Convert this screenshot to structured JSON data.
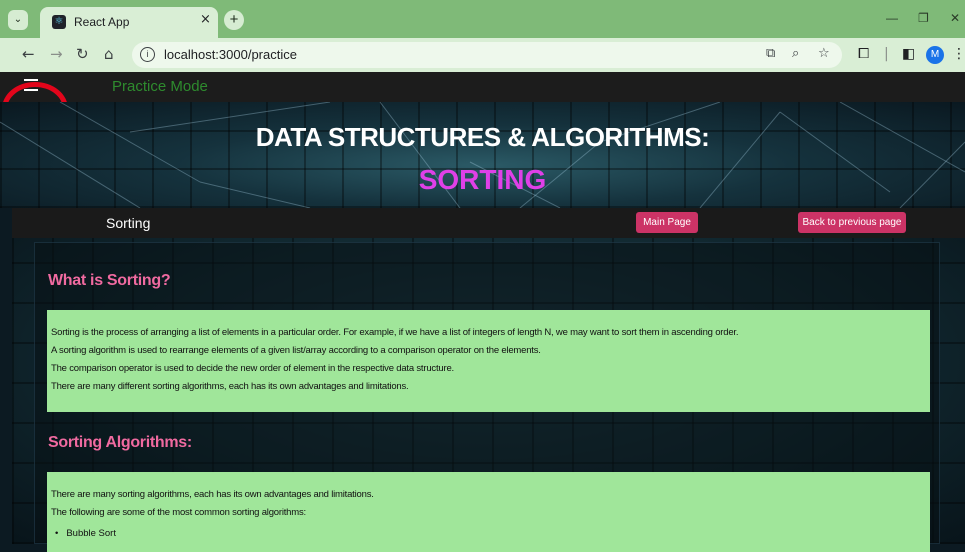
{
  "browser": {
    "tab_title": "React App",
    "tab_close": "×",
    "new_tab": "+",
    "url": "localhost:3000/practice",
    "profile_initial": "M",
    "accent": "#7fba78"
  },
  "header": {
    "mode_title": "Practice Mode"
  },
  "hero": {
    "title": "DATA STRUCTURES & ALGORITHMS:",
    "subtitle": "SORTING",
    "subtitle_color": "#e040e8"
  },
  "subnav": {
    "title": "Sorting",
    "main_page_label": "Main Page",
    "back_label": "Back to previous page",
    "button_color": "#cc3366"
  },
  "sections": [
    {
      "heading": "What is Sorting?",
      "lines": [
        "Sorting is the process of arranging a list of elements in a particular order. For example, if we have a list of integers of length N, we may want to sort them in ascending order.",
        "A sorting algorithm is used to rearrange elements of a given list/array according to a comparison operator on the elements.",
        "The comparison operator is used to decide the new order of element in the respective data structure.",
        "There are many different sorting algorithms, each has its own advantages and limitations."
      ]
    },
    {
      "heading": "Sorting Algorithms:",
      "lines": [
        "There are many sorting algorithms, each has its own advantages and limitations.",
        "The following are some of the most common sorting algorithms:"
      ],
      "bullets": [
        "Bubble Sort"
      ]
    }
  ]
}
